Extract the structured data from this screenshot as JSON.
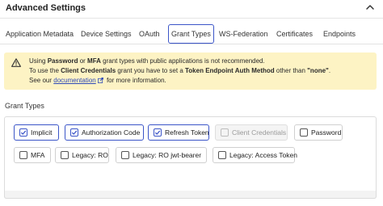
{
  "header": {
    "title": "Advanced Settings",
    "chevron_icon": "chevron-up-icon"
  },
  "tabs": [
    {
      "label": "Application Metadata",
      "active": false
    },
    {
      "label": "Device Settings",
      "active": false
    },
    {
      "label": "OAuth",
      "active": false
    },
    {
      "label": "Grant Types",
      "active": true
    },
    {
      "label": "WS-Federation",
      "active": false
    },
    {
      "label": "Certificates",
      "active": false
    },
    {
      "label": "Endpoints",
      "active": false
    }
  ],
  "alert": {
    "icon": "warning-icon",
    "line1": {
      "t1": "Using ",
      "b1": "Password",
      "t2": " or ",
      "b2": "MFA",
      "t3": " grant types with public applications is not recommended."
    },
    "line2": {
      "t1": "To use the ",
      "b1": "Client Credentials",
      "t2": " grant you have to set a ",
      "b2": "Token Endpoint Auth Method",
      "t3": " other than ",
      "b3": "\"none\"",
      "t4": "."
    },
    "line3": {
      "t1": "See our ",
      "link": "documentation",
      "t2": " for more information."
    },
    "colors": {
      "background": "#fdf3c4",
      "link": "#2f4bb8"
    }
  },
  "grant_types": {
    "label": "Grant Types",
    "accent": "#3b55c8",
    "options": [
      {
        "label": "Implicit",
        "checked": true,
        "disabled": false
      },
      {
        "label": "Authorization Code",
        "checked": true,
        "disabled": false
      },
      {
        "label": "Refresh Token",
        "checked": true,
        "disabled": false
      },
      {
        "label": "Client Credentials",
        "checked": false,
        "disabled": true
      },
      {
        "label": "Password",
        "checked": false,
        "disabled": false
      },
      {
        "label": "MFA",
        "checked": false,
        "disabled": false
      },
      {
        "label": "Legacy: RO",
        "checked": false,
        "disabled": false
      },
      {
        "label": "Legacy: RO jwt-bearer",
        "checked": false,
        "disabled": false
      },
      {
        "label": "Legacy: Access Token",
        "checked": false,
        "disabled": false
      }
    ]
  }
}
